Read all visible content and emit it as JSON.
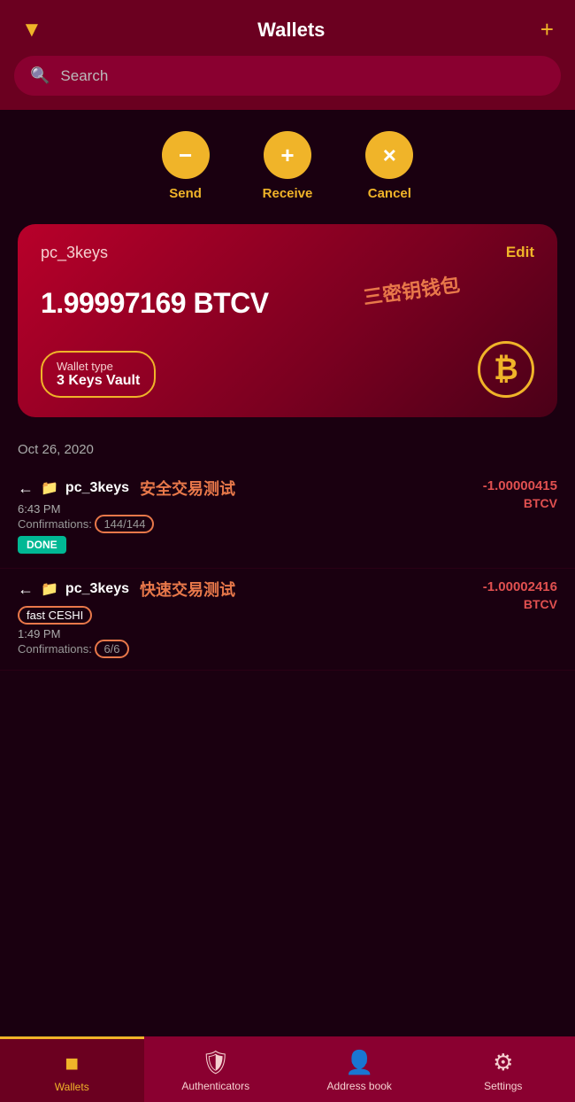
{
  "header": {
    "title": "Wallets",
    "filter_icon": "▼",
    "add_icon": "+"
  },
  "search": {
    "placeholder": "Search"
  },
  "actions": [
    {
      "id": "send",
      "icon": "−",
      "label": "Send"
    },
    {
      "id": "receive",
      "icon": "+",
      "label": "Receive"
    },
    {
      "id": "cancel",
      "icon": "×",
      "label": "Cancel"
    }
  ],
  "wallet_card": {
    "name": "pc_3keys",
    "edit_label": "Edit",
    "balance": "1.99997169 BTCV",
    "type_label": "Wallet type",
    "type_value": "3 Keys Vault",
    "annotation": "三密钥钱包",
    "btc_symbol": "₿"
  },
  "date_header": "Oct 26, 2020",
  "transactions": [
    {
      "arrow": "←",
      "wallet_icon": "🗂",
      "name": "pc_3keys",
      "name_annotation": "安全交易测试",
      "time": "6:43 PM",
      "confirmations_label": "Confirmations:",
      "confirmations_value": "144/144",
      "status": "DONE",
      "amount": "-1.00000415",
      "currency": "BTCV"
    },
    {
      "arrow": "←",
      "wallet_icon": "🗂",
      "name": "pc_3keys",
      "name_annotation": "快速交易测试",
      "fast_label": "fast CESHI",
      "time": "1:49 PM",
      "confirmations_label": "Confirmations:",
      "confirmations_value": "6/6",
      "amount": "-1.00002416",
      "currency": "BTCV"
    }
  ],
  "bottom_nav": [
    {
      "id": "wallets",
      "icon": "▣",
      "label": "Wallets",
      "active": true
    },
    {
      "id": "authenticators",
      "icon": "🛡",
      "label": "Authenticators",
      "active": false
    },
    {
      "id": "address-book",
      "icon": "👤",
      "label": "Address book",
      "active": false
    },
    {
      "id": "settings",
      "icon": "⚙",
      "label": "Settings",
      "active": false
    }
  ]
}
